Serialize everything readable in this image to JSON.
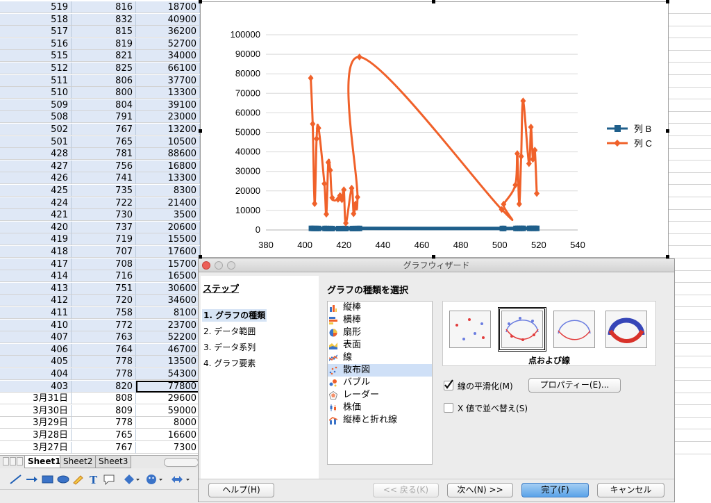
{
  "sheet": {
    "rows": [
      [
        "519",
        "816",
        "18700"
      ],
      [
        "518",
        "832",
        "40900"
      ],
      [
        "517",
        "815",
        "36200"
      ],
      [
        "516",
        "819",
        "52700"
      ],
      [
        "515",
        "821",
        "34000"
      ],
      [
        "512",
        "825",
        "66100"
      ],
      [
        "511",
        "806",
        "37700"
      ],
      [
        "510",
        "800",
        "13300"
      ],
      [
        "509",
        "804",
        "39100"
      ],
      [
        "508",
        "791",
        "23000"
      ],
      [
        "502",
        "767",
        "13200"
      ],
      [
        "501",
        "765",
        "10500"
      ],
      [
        "428",
        "781",
        "88600"
      ],
      [
        "427",
        "756",
        "16800"
      ],
      [
        "426",
        "741",
        "13300"
      ],
      [
        "425",
        "735",
        "8300"
      ],
      [
        "424",
        "722",
        "21400"
      ],
      [
        "421",
        "730",
        "3500"
      ],
      [
        "420",
        "737",
        "20600"
      ],
      [
        "419",
        "719",
        "15500"
      ],
      [
        "418",
        "707",
        "17600"
      ],
      [
        "417",
        "708",
        "15700"
      ],
      [
        "414",
        "716",
        "16500"
      ],
      [
        "413",
        "751",
        "30600"
      ],
      [
        "412",
        "720",
        "34600"
      ],
      [
        "411",
        "758",
        "8100"
      ],
      [
        "410",
        "772",
        "23700"
      ],
      [
        "407",
        "763",
        "52200"
      ],
      [
        "406",
        "764",
        "46700"
      ],
      [
        "405",
        "778",
        "13500"
      ],
      [
        "404",
        "778",
        "54300"
      ],
      [
        "403",
        "820",
        "77800"
      ],
      [
        "3月31日",
        "808",
        "29600"
      ],
      [
        "3月30日",
        "809",
        "59000"
      ],
      [
        "3月29日",
        "778",
        "8000"
      ],
      [
        "3月28日",
        "765",
        "16600"
      ],
      [
        "3月27日",
        "767",
        "7300"
      ]
    ],
    "tabs": [
      "Sheet1",
      "Sheet2",
      "Sheet3"
    ]
  },
  "chart_data": {
    "type": "scatter",
    "xlim": [
      380,
      540
    ],
    "ylim": [
      0,
      100000
    ],
    "xticks": [
      "380",
      "400",
      "420",
      "440",
      "460",
      "480",
      "500",
      "520",
      "540"
    ],
    "yticks": [
      "0",
      "10000",
      "20000",
      "30000",
      "40000",
      "50000",
      "60000",
      "70000",
      "80000",
      "90000",
      "100000"
    ],
    "legend_position": "right",
    "series": [
      {
        "name": "列 B",
        "color": "#1f5f8b",
        "x": [
          403,
          404,
          405,
          406,
          407,
          410,
          411,
          412,
          413,
          414,
          417,
          418,
          419,
          420,
          421,
          424,
          425,
          426,
          427,
          428,
          501,
          502,
          508,
          509,
          510,
          511,
          512,
          515,
          516,
          517,
          518,
          519
        ],
        "y": [
          820,
          778,
          778,
          764,
          763,
          772,
          758,
          720,
          751,
          716,
          708,
          707,
          719,
          737,
          730,
          722,
          735,
          741,
          756,
          781,
          765,
          767,
          791,
          804,
          800,
          806,
          825,
          821,
          819,
          815,
          832,
          816
        ]
      },
      {
        "name": "列 C",
        "color": "#f0612a",
        "x": [
          403,
          404,
          405,
          406,
          407,
          410,
          411,
          412,
          413,
          414,
          417,
          418,
          419,
          420,
          421,
          424,
          425,
          426,
          427,
          428,
          501,
          502,
          508,
          509,
          510,
          511,
          512,
          515,
          516,
          517,
          518,
          519
        ],
        "y": [
          77800,
          54300,
          13500,
          46700,
          52200,
          23700,
          8100,
          34600,
          30600,
          16500,
          15700,
          17600,
          15500,
          20600,
          3500,
          21400,
          8300,
          13300,
          16800,
          88600,
          10500,
          13200,
          23000,
          39100,
          13300,
          37700,
          66100,
          34000,
          52700,
          36200,
          40900,
          18700
        ]
      }
    ]
  },
  "dialog": {
    "title": "グラフウィザード",
    "steps_title": "ステップ",
    "steps": [
      "1. グラフの種類",
      "2. データ範囲",
      "3. データ系列",
      "4. グラフ要素"
    ],
    "content_title": "グラフの種類を選択",
    "types": [
      "縦棒",
      "横棒",
      "扇形",
      "表面",
      "線",
      "散布図",
      "バブル",
      "レーダー",
      "株価",
      "縦棒と折れ線"
    ],
    "selected_type": "散布図",
    "variant_label": "点および線",
    "smooth_label": "線の平滑化(M)",
    "smooth_checked": true,
    "properties_button": "プロパティー(E)...",
    "sort_label": "X 値で並べ替え(S)",
    "sort_checked": false,
    "buttons": {
      "help": "ヘルプ(H)",
      "back": "<< 戻る(K)",
      "next": "次へ(N) >>",
      "finish": "完了(F)",
      "cancel": "キャンセル"
    }
  }
}
